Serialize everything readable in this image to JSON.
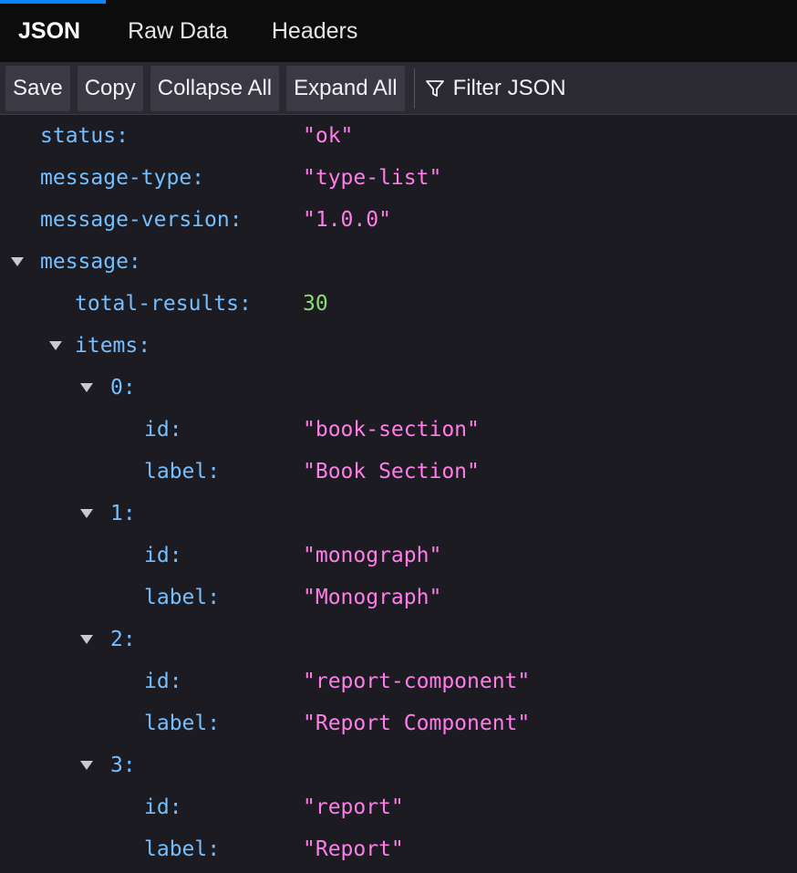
{
  "tabs": [
    {
      "label": "JSON"
    },
    {
      "label": "Raw Data"
    },
    {
      "label": "Headers"
    }
  ],
  "toolbar": {
    "save": "Save",
    "copy": "Copy",
    "collapse_all": "Collapse All",
    "expand_all": "Expand All",
    "filter_placeholder": "Filter JSON"
  },
  "tree": {
    "status": {
      "key": "status:",
      "value": "\"ok\""
    },
    "message_type": {
      "key": "message-type:",
      "value": "\"type-list\""
    },
    "message_version": {
      "key": "message-version:",
      "value": "\"1.0.0\""
    },
    "message": {
      "key": "message:"
    },
    "total_results": {
      "key": "total-results:",
      "value": "30"
    },
    "items": {
      "key": "items:"
    },
    "list": [
      {
        "index": "0:",
        "id_key": "id:",
        "id": "\"book-section\"",
        "label_key": "label:",
        "label": "\"Book Section\""
      },
      {
        "index": "1:",
        "id_key": "id:",
        "id": "\"monograph\"",
        "label_key": "label:",
        "label": "\"Monograph\""
      },
      {
        "index": "2:",
        "id_key": "id:",
        "id": "\"report-component\"",
        "label_key": "label:",
        "label": "\"Report Component\""
      },
      {
        "index": "3:",
        "id_key": "id:",
        "id": "\"report\"",
        "label_key": "label:",
        "label": "\"Report\""
      }
    ]
  },
  "colors": {
    "key": "#75bfff",
    "string": "#ff7de9",
    "number": "#86de74",
    "accent": "#0a84ff"
  }
}
